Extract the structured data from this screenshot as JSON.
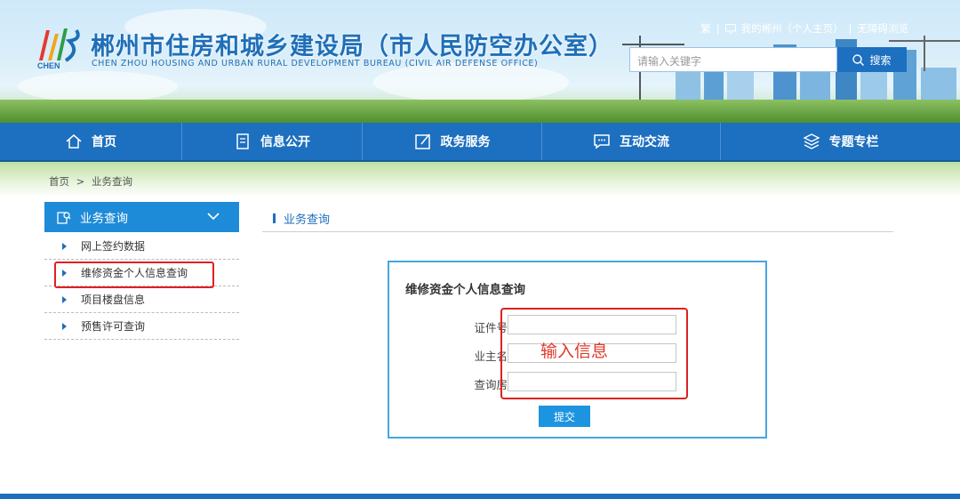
{
  "header": {
    "title": "郴州市住房和城乡建设局（市人民防空办公室）",
    "subtitle": "CHEN ZHOU HOUSING AND URBAN RURAL DEVELOPMENT BUREAU (CIVIL AIR DEFENSE OFFICE)",
    "logo_text": "CHEN",
    "logo_cn": "郴州",
    "top_links": [
      "繁",
      "我的郴州（个人主页）",
      "无障碍浏览"
    ],
    "search_placeholder": "请输入关键字",
    "search_button": "搜索"
  },
  "nav": {
    "items": [
      {
        "label": "首页",
        "icon": "home-icon"
      },
      {
        "label": "信息公开",
        "icon": "document-icon"
      },
      {
        "label": "政务服务",
        "icon": "edit-icon"
      },
      {
        "label": "互动交流",
        "icon": "chat-icon"
      },
      {
        "label": "专题专栏",
        "icon": "layers-icon"
      }
    ]
  },
  "breadcrumb": {
    "home": "首页",
    "sep": ">",
    "current": "业务查询"
  },
  "sidebar": {
    "heading": "业务查询",
    "items": [
      {
        "label": "网上签约数据"
      },
      {
        "label": "维修资金个人信息查询"
      },
      {
        "label": "项目楼盘信息"
      },
      {
        "label": "预售许可查询"
      }
    ]
  },
  "main": {
    "section_title": "业务查询",
    "form": {
      "title": "维修资金个人信息查询",
      "fields": [
        {
          "label": "证件号码：",
          "value": ""
        },
        {
          "label": "业主名称：",
          "value": ""
        },
        {
          "label": "查询房号：",
          "value": ""
        }
      ],
      "submit_label": "提交"
    },
    "annotation": "输入信息"
  },
  "colors": {
    "primary": "#1d6fbf",
    "accent": "#1d8bd8",
    "annotation_red": "#e02020"
  }
}
